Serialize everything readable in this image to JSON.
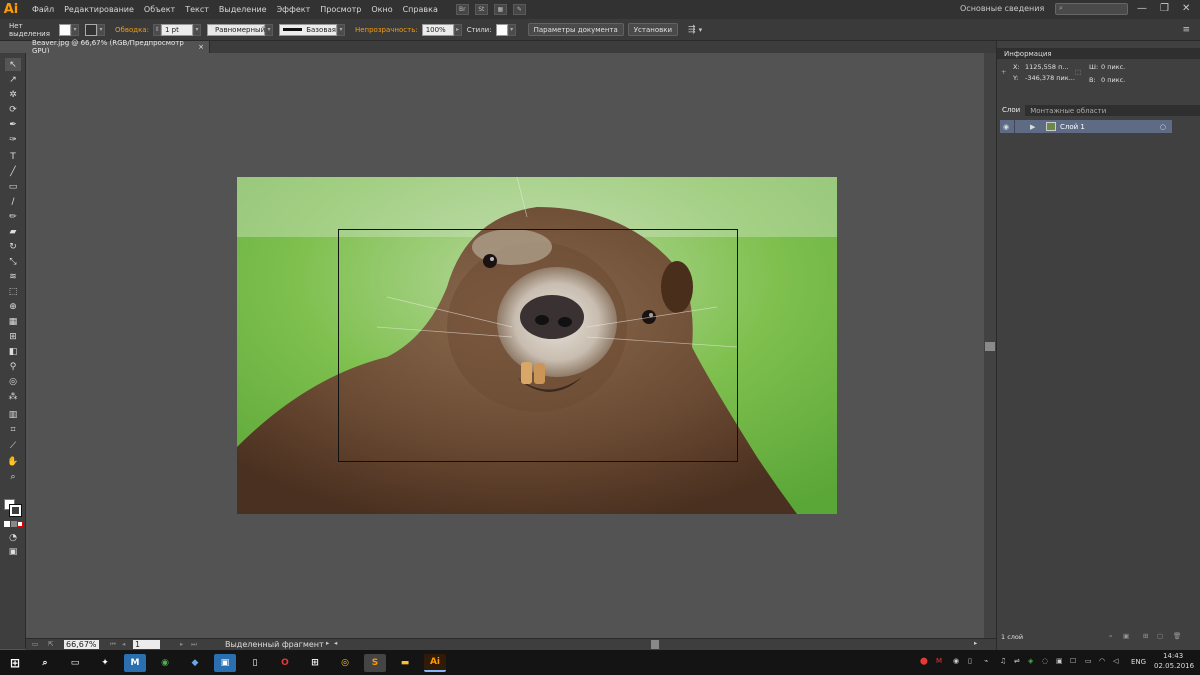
{
  "app": {
    "logo": "Ai"
  },
  "menu": [
    "Файл",
    "Редактирование",
    "Объект",
    "Текст",
    "Выделение",
    "Эффект",
    "Просмотр",
    "Окно",
    "Справка"
  ],
  "menu_icons": [
    "Br",
    "St",
    "grid-icon",
    "brush-icon"
  ],
  "workspace": "Основные сведения",
  "search_placeholder": "",
  "control": {
    "selection": "Нет выделения",
    "stroke_label": "Обводка:",
    "stroke_value": "1 pt",
    "profile": "Равномерный",
    "brush": "Базовая",
    "opacity_label": "Непрозрачность:",
    "opacity_value": "100%",
    "styles_label": "Стили:",
    "doc_settings": "Параметры документа",
    "preferences": "Установки"
  },
  "document": {
    "tab_title": "Beaver.jpg @ 66,67% (RGB/Предпросмотр GPU)",
    "close": "×"
  },
  "status": {
    "zoom": "66,67%",
    "page": "1",
    "text": "Выделенный фрагмент"
  },
  "info_panel": {
    "title": "Информация",
    "x_label": "X:",
    "x_value": "1125,558 п...",
    "y_label": "Y:",
    "y_value": "-346,378 пик...",
    "w_label": "Ш:",
    "w_value": "0 пикс.",
    "h_label": "В:",
    "h_value": "0 пикс."
  },
  "layers_panel": {
    "tabs": [
      "Слои",
      "Монтажные области"
    ],
    "layers": [
      {
        "name": "Слой 1"
      }
    ],
    "count": "1 слой"
  },
  "taskbar": {
    "lang": "ENG",
    "time": "14:43",
    "date": "02.05.2016",
    "apps": [
      "task-view",
      "thunderbird-app",
      "chrome-green-app",
      "visual-studio-app",
      "calc-app",
      "phone-app",
      "opera-app",
      "store-app",
      "chrome-app",
      "sublime-app",
      "explorer-app",
      "illustrator-app"
    ]
  },
  "colors": {
    "accent": "#ff9a00",
    "panel": "#404040",
    "layer_highlight": "#5d6b85"
  }
}
